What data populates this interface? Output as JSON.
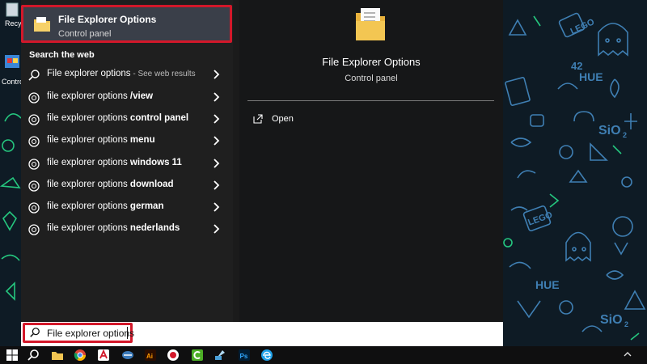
{
  "desktop": {
    "icons": [
      {
        "name": "recycle-bin",
        "label": "Recy"
      },
      {
        "name": "control-panel",
        "label": "Contro"
      }
    ]
  },
  "best_match": {
    "title": "File Explorer Options",
    "subtitle": "Control panel",
    "icon": "folder-icon"
  },
  "web_section": {
    "heading": "Search the web",
    "items": [
      {
        "base": "File explorer options",
        "bold": "",
        "sub": " - See web results",
        "icon": "search-icon"
      },
      {
        "base": "file explorer options ",
        "bold": "/view",
        "sub": "",
        "icon": "web-search-icon"
      },
      {
        "base": "file explorer options ",
        "bold": "control panel",
        "sub": "",
        "icon": "web-search-icon"
      },
      {
        "base": "file explorer options ",
        "bold": "menu",
        "sub": "",
        "icon": "web-search-icon"
      },
      {
        "base": "file explorer options ",
        "bold": "windows 11",
        "sub": "",
        "icon": "web-search-icon"
      },
      {
        "base": "file explorer options ",
        "bold": "download",
        "sub": "",
        "icon": "web-search-icon"
      },
      {
        "base": "file explorer options ",
        "bold": "german",
        "sub": "",
        "icon": "web-search-icon"
      },
      {
        "base": "file explorer options ",
        "bold": "nederlands",
        "sub": "",
        "icon": "web-search-icon"
      }
    ]
  },
  "preview": {
    "title": "File Explorer Options",
    "subtitle": "Control panel",
    "actions": [
      {
        "label": "Open",
        "icon": "open-icon"
      }
    ]
  },
  "search": {
    "value": "File explorer options",
    "icon": "search-icon"
  },
  "taskbar": {
    "icons": [
      "windows-start-icon",
      "search-icon",
      "file-explorer-icon",
      "chrome-icon",
      "acrobat-icon",
      "teamviewer-icon",
      "illustrator-icon",
      "recorder-icon",
      "camtasia-icon",
      "tool-icon",
      "photoshop-icon",
      "edge-icon",
      "notification-icon"
    ]
  },
  "wallpaper": {
    "text": [
      "LEGO",
      "42",
      "HUE",
      "SiO",
      "2",
      "LEGO",
      "HUE",
      "SiO",
      "2",
      "42"
    ]
  },
  "colors": {
    "highlight": "#d3182a",
    "best_match_bg": "#3a3f49",
    "menu_bg": "#1f1f1f",
    "wallpaper_bg": "#0d1a24",
    "doodle_blue": "#3f7fb3",
    "doodle_green": "#25c77f"
  }
}
